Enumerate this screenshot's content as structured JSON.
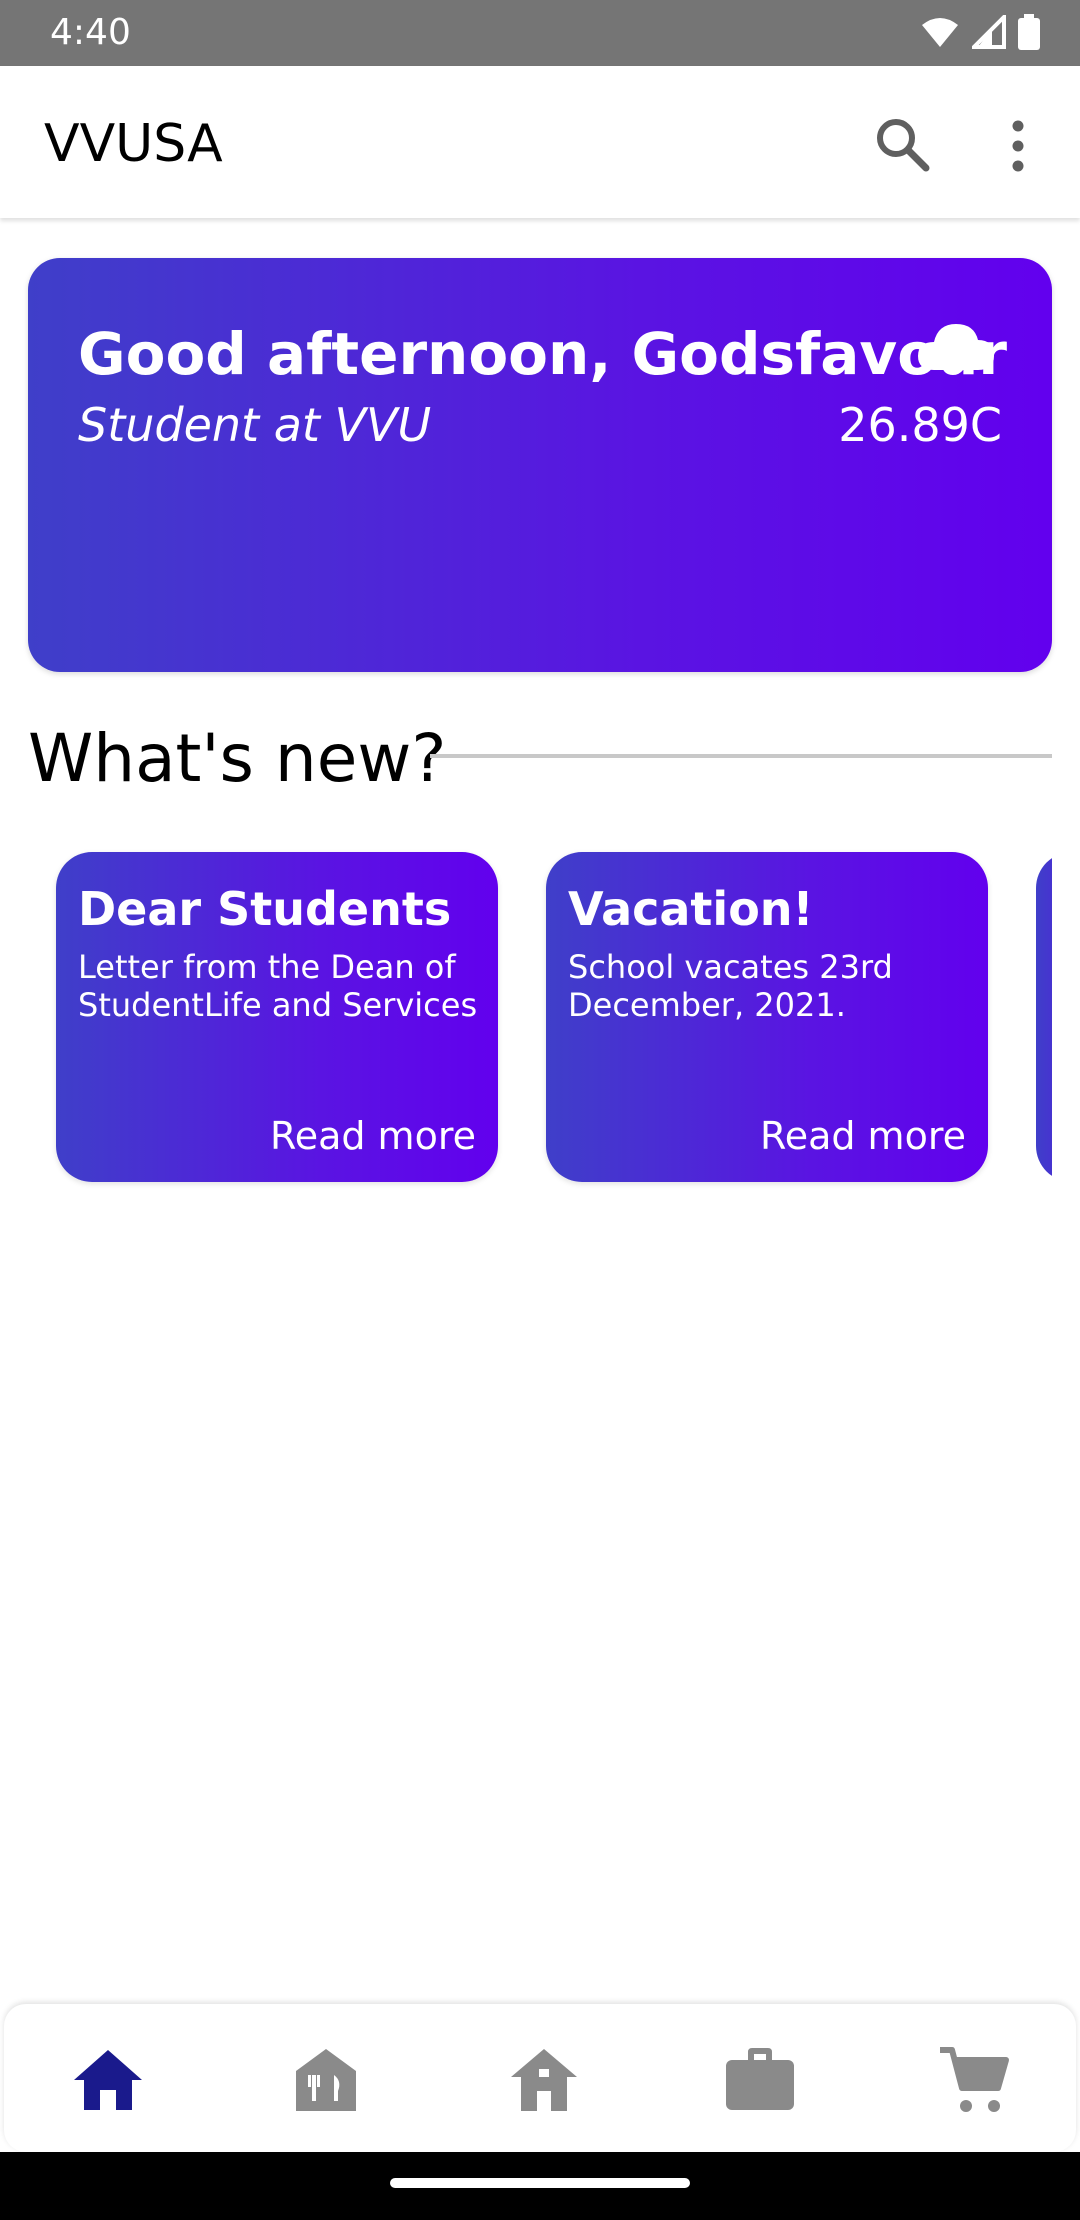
{
  "status_bar": {
    "time": "4:40"
  },
  "app_bar": {
    "title": "VVUSA"
  },
  "hero": {
    "greeting": "Good afternoon, Godsfavour",
    "role": "Student at VVU",
    "temperature": "26.89C",
    "weather_icon": "cloud-icon"
  },
  "whats_new": {
    "title": "What's new?",
    "cards": [
      {
        "title": "Dear Students",
        "body": "Letter from the Dean of StudentLife and Services",
        "action": "Read more"
      },
      {
        "title": "Vacation!",
        "body": "School vacates 23rd December, 2021.",
        "action": "Read more"
      }
    ]
  },
  "bottom_nav": {
    "items": [
      "home-icon",
      "dining-icon",
      "housing-icon",
      "work-icon",
      "cart-icon"
    ],
    "active_index": 0,
    "active_color": "#1a1a8c",
    "inactive_color": "#8a8a8a"
  },
  "colors": {
    "gradient_start": "#3f3fc9",
    "gradient_end": "#6200ee",
    "status_bar": "#757575"
  }
}
